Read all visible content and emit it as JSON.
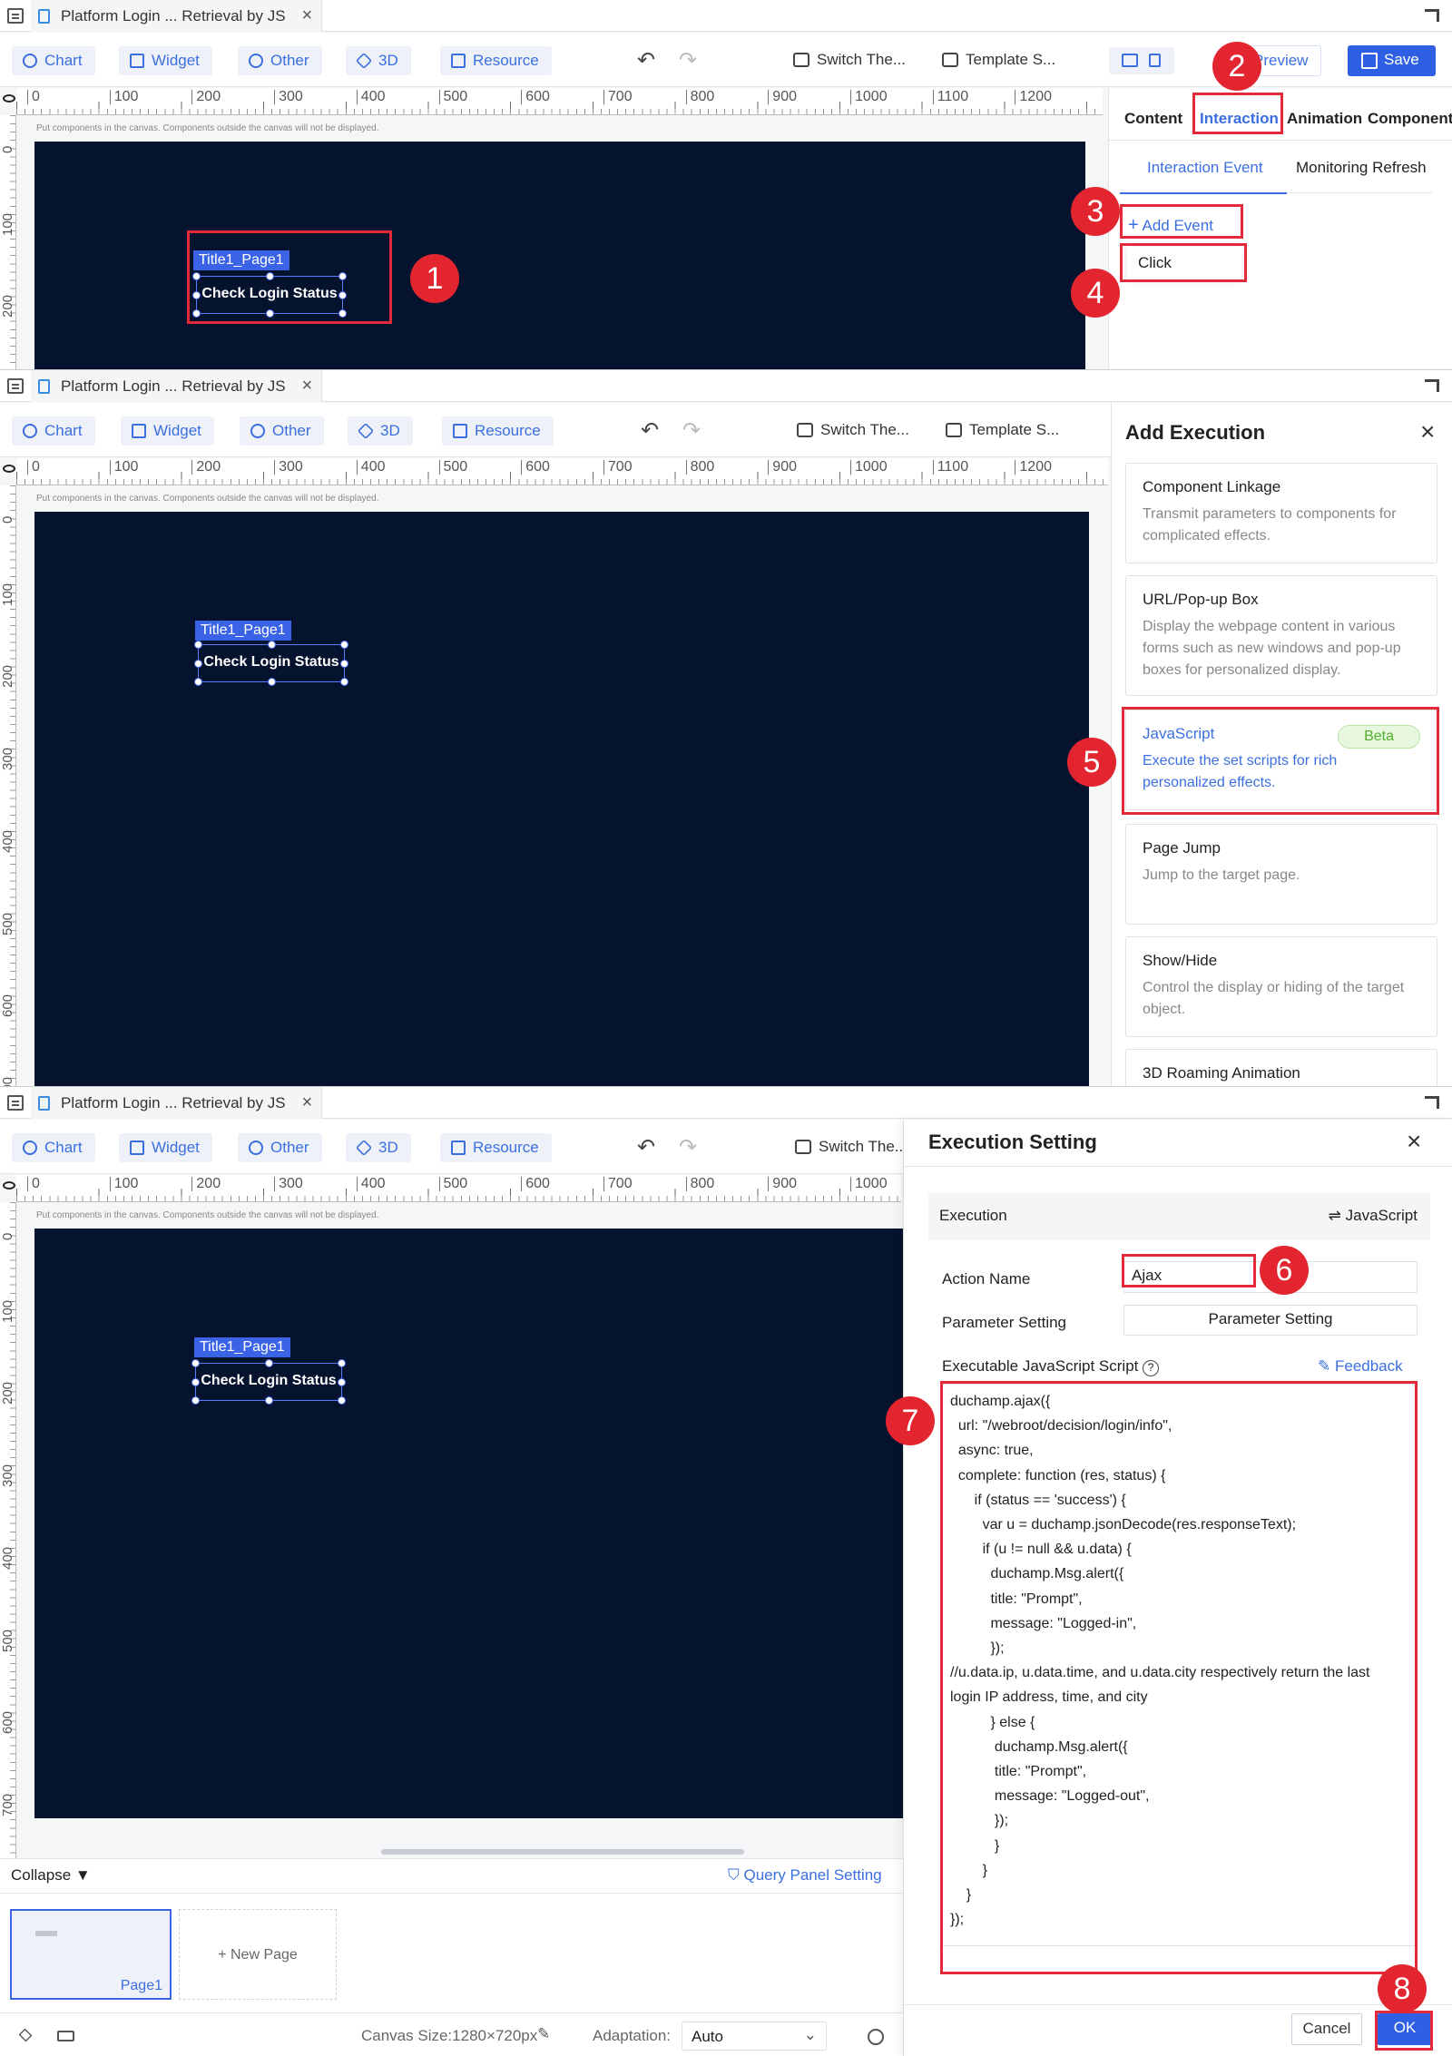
{
  "tab": {
    "title": "Platform Login ... Retrieval by JS",
    "close": "×"
  },
  "toolbar": {
    "chart": "Chart",
    "widget": "Widget",
    "other": "Other",
    "threed": "3D",
    "resource": "Resource",
    "undo": "↶",
    "redo": "↷",
    "switch_theme": "Switch The...",
    "template": "Template S...",
    "preview": "Preview",
    "save": "Save"
  },
  "ruler": {
    "h": [
      "0",
      "100",
      "200",
      "300",
      "400",
      "500",
      "600",
      "700",
      "800",
      "900",
      "1000",
      "1100",
      "1200"
    ],
    "v": [
      "0",
      "100",
      "200",
      "300",
      "400",
      "500",
      "600",
      "700"
    ]
  },
  "canvas": {
    "hint": "Put components in the canvas. Components outside the canvas will not be displayed.",
    "component_label": "Title1_Page1",
    "component_text": "Check Login Status"
  },
  "panel1": {
    "tabs": [
      "Content",
      "Interaction",
      "Animation",
      "Component"
    ],
    "subtabs": [
      "Interaction Event",
      "Monitoring Refresh"
    ],
    "add_event": "Add Event",
    "event": "Click"
  },
  "panel2": {
    "title": "Add Execution",
    "cards": [
      {
        "title": "Component Linkage",
        "desc": "Transmit parameters to components for complicated effects."
      },
      {
        "title": "URL/Pop-up Box",
        "desc": "Display the webpage content in various forms such as new windows and pop-up boxes for personalized display."
      },
      {
        "title": "JavaScript",
        "badge": "Beta",
        "desc": "Execute the set scripts for rich personalized effects."
      },
      {
        "title": "Page Jump",
        "desc": "Jump to the target page."
      },
      {
        "title": "Show/Hide",
        "desc": "Control the display or hiding of the target object."
      },
      {
        "title": "3D Roaming Animation",
        "desc": ""
      }
    ]
  },
  "panel3": {
    "title": "Execution Setting",
    "execution_label": "Execution",
    "execution_value": "JavaScript",
    "action_name_label": "Action Name",
    "action_name_value": "Ajax",
    "param_label": "Parameter Setting",
    "param_button": "Parameter Setting",
    "script_label": "Executable JavaScript Script",
    "feedback": "Feedback",
    "code": "duchamp.ajax({\n  url: \"/webroot/decision/login/info\",\n  async: true,\n  complete: function (res, status) {\n      if (status == 'success') {\n        var u = duchamp.jsonDecode(res.responseText);\n        if (u != null && u.data) {\n          duchamp.Msg.alert({\n          title: \"Prompt\",\n          message: \"Logged-in\",\n          });\n//u.data.ip, u.data.time, and u.data.city respectively return the last\nlogin IP address, time, and city\n          } else {\n           duchamp.Msg.alert({\n           title: \"Prompt\",\n           message: \"Logged-out\",\n           });\n           }\n        }\n    }\n});",
    "cancel": "Cancel",
    "ok": "OK"
  },
  "bottom": {
    "collapse": "Collapse",
    "query_panel": "Query Panel Setting",
    "page": "Page1",
    "new_page": "New Page",
    "canvas_size": "Canvas Size:1280×720px",
    "adaptation_label": "Adaptation:",
    "adaptation_value": "Auto"
  },
  "steps": [
    "1",
    "2",
    "3",
    "4",
    "5",
    "6",
    "7",
    "8"
  ],
  "colors": {
    "accent": "#2f5fe3",
    "canvas_bg": "#06132e",
    "highlight": "#e22a3a"
  }
}
